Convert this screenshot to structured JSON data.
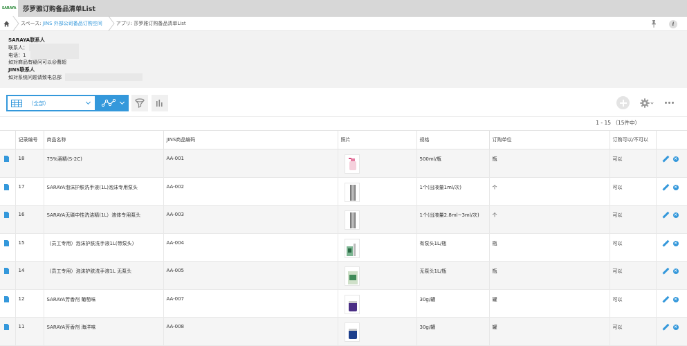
{
  "app": {
    "logo": "SARAYA",
    "title": "莎罗雅订购备品清单List"
  },
  "breadcrumb": {
    "space_prefix": "スペース: ",
    "space_name": "JINS 外部公司备品订购空间",
    "app_label": "アプリ: 莎罗雅订购备品清单List"
  },
  "contact": {
    "saraya_heading": "SARAYA联系人",
    "contact_person": "联系人：",
    "phone": "电话：1",
    "note1": "如对商品有疑问可以@曹超",
    "jins_heading": "JINS联系人",
    "note2": "如对系统问题请致电总部"
  },
  "toolbar": {
    "view_label": "（全部）"
  },
  "pager": "1 - 15 （15件中）",
  "table": {
    "headers": [
      "",
      "记录编号",
      "商品名称",
      "JINS商品编码",
      "照片",
      "规格",
      "订购单位",
      "订购可以/不可以",
      ""
    ],
    "rows": [
      {
        "id": "18",
        "name": "75%酒精(S-2C)",
        "code": "AA-001",
        "spec": "500ml/瓶",
        "unit": "瓶",
        "orderable": "可以",
        "photo": "spray"
      },
      {
        "id": "17",
        "name": "SARAYA泡沫护肤洗手液(1L)泡沫专用泵头",
        "code": "AA-002",
        "spec": "1个(出液量1ml/次)",
        "unit": "个",
        "orderable": "可以",
        "photo": "pump"
      },
      {
        "id": "16",
        "name": "SARAYA无磷中性洗洁精(1L）液体专用泵头",
        "code": "AA-003",
        "spec": "1个(出液量2.8ml~3ml/次)",
        "unit": "个",
        "orderable": "可以",
        "photo": "pump"
      },
      {
        "id": "15",
        "name": "（员工专用）泡沫护肤洗手液1L(带泵头)",
        "code": "AA-004",
        "spec": "有泵头1L/瓶",
        "unit": "瓶",
        "orderable": "可以",
        "photo": "bottle-pump"
      },
      {
        "id": "14",
        "name": "（员工专用）泡沫护肤洗手液1L 无泵头",
        "code": "AA-005",
        "spec": "无泵头1L/瓶",
        "unit": "瓶",
        "orderable": "可以",
        "photo": "bottle"
      },
      {
        "id": "12",
        "name": "SARAYA芳香剂 葡萄味",
        "code": "AA-007",
        "spec": "30g/罐",
        "unit": "罐",
        "orderable": "可以",
        "photo": "can-purple"
      },
      {
        "id": "11",
        "name": "SARAYA芳香剂 海洋味",
        "code": "AA-008",
        "spec": "30g/罐",
        "unit": "罐",
        "orderable": "可以",
        "photo": "can-blue"
      }
    ]
  }
}
